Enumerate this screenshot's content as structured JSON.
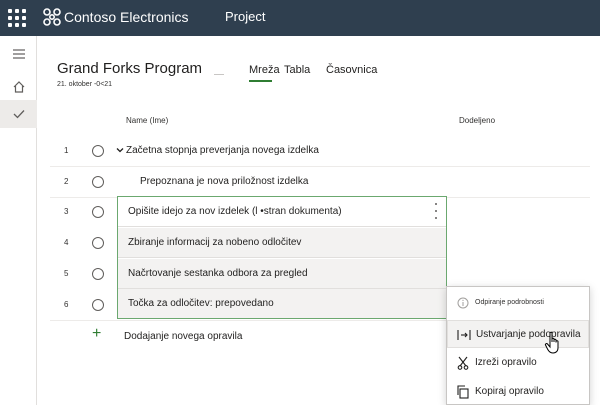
{
  "topbar": {
    "brand": "Contoso Electronics",
    "app": "Project"
  },
  "rail": {
    "icons": [
      "hamburger-icon",
      "home-icon",
      "check-icon"
    ]
  },
  "plan": {
    "title": "Grand Forks Program",
    "date": "21. oktober -0<21"
  },
  "tabs": [
    {
      "label": "Mreža",
      "active": true
    },
    {
      "label": "Tabla",
      "active": false
    },
    {
      "label": "Časovnica",
      "active": false
    }
  ],
  "columns": {
    "name": "Name (Ime)",
    "assigned": "Dodeljeno"
  },
  "tasks": [
    {
      "num": "1",
      "name": "Začetna stopnja preverjanja novega izdelka"
    },
    {
      "num": "2",
      "name": "Prepoznana je nova priložnost izdelka"
    },
    {
      "num": "3",
      "name": "Opišite idejo za nov izdelek (l •stran dokumenta)"
    },
    {
      "num": "4",
      "name": "Zbiranje informacij za nobeno odločitev"
    },
    {
      "num": "5",
      "name": "Načrtovanje sestanka odbora za pregled"
    },
    {
      "num": "6",
      "name": "Točka za odločitev: prepovedano"
    }
  ],
  "add_task": "Dodajanje novega opravila",
  "context_menu": {
    "items": [
      {
        "label": "Odpiranje podrobnosti",
        "icon": "info-icon"
      },
      {
        "label": "Ustvarjanje podopravila",
        "icon": "indent-icon"
      },
      {
        "label": "Izreži opravilo",
        "icon": "scissors-icon"
      },
      {
        "label": "Kopiraj opravilo",
        "icon": "copy-icon"
      }
    ]
  },
  "colors": {
    "topbar": "#2f3f4f",
    "accent": "#2f7d32",
    "selection_border": "#6ba86f"
  }
}
